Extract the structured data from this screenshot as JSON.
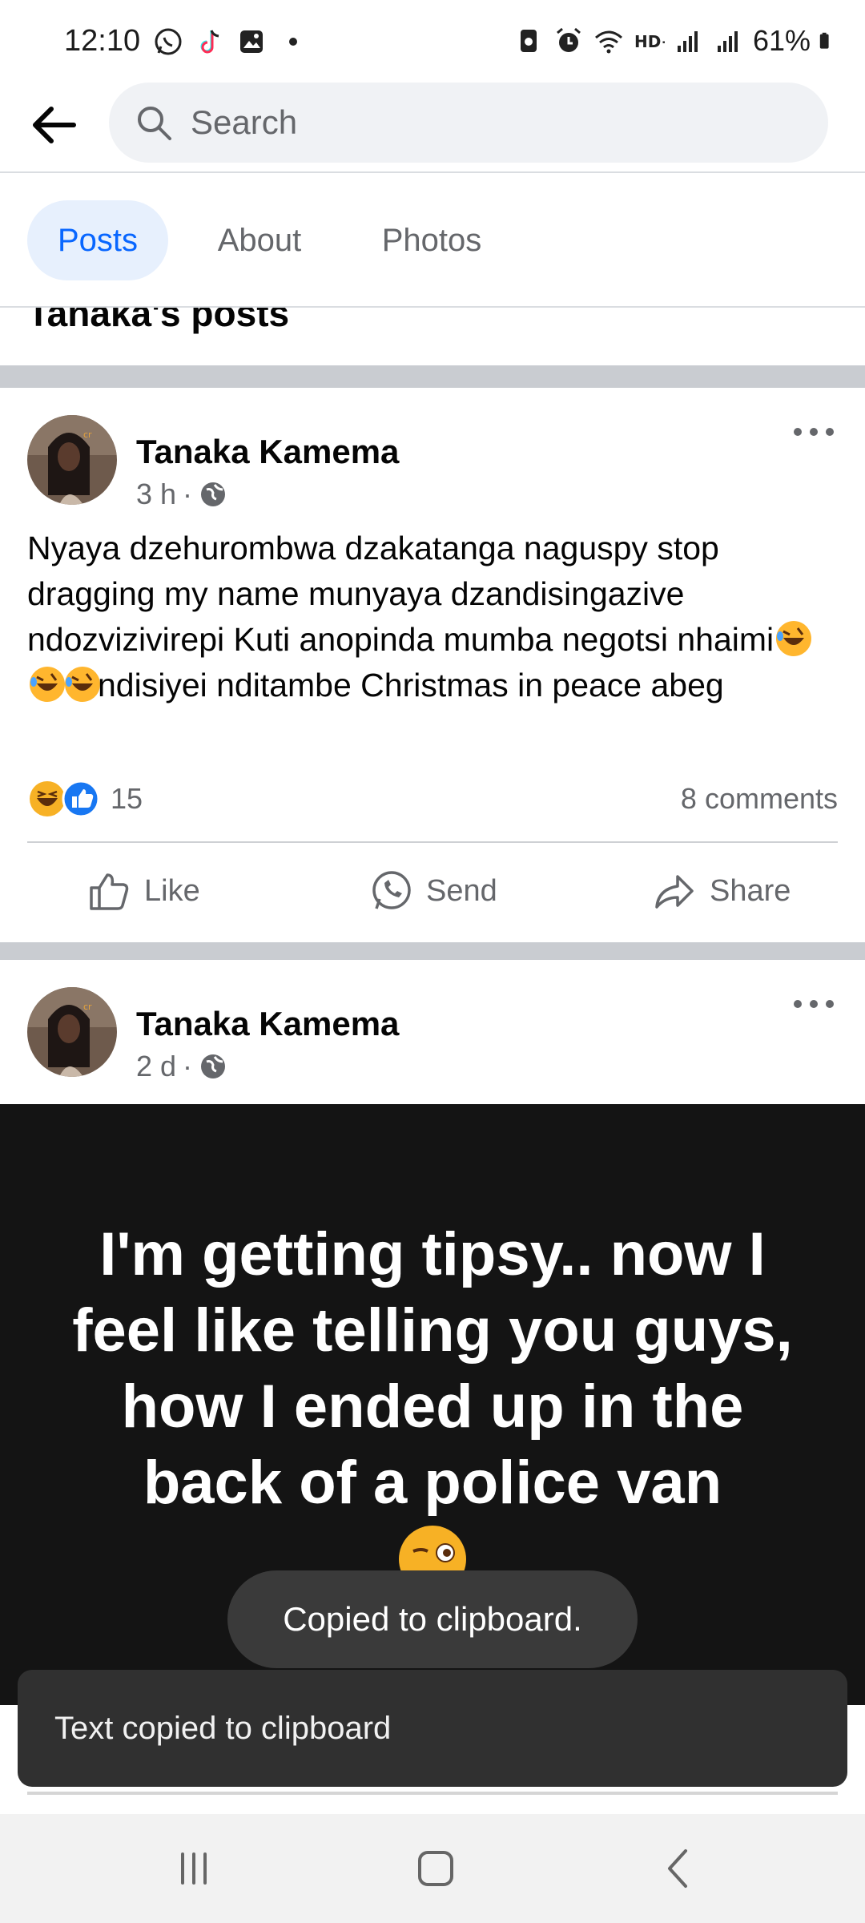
{
  "status_bar": {
    "time": "12:10",
    "battery": "61%"
  },
  "search": {
    "placeholder": "Search"
  },
  "tabs": [
    {
      "label": "Posts",
      "active": true
    },
    {
      "label": "About",
      "active": false
    },
    {
      "label": "Photos",
      "active": false
    }
  ],
  "section_title": "Tanaka's posts",
  "posts": [
    {
      "author": "Tanaka Kamema",
      "time": "3 h",
      "text_part1": "Nyaya dzehurombwa dzakatanga naguspy stop dragging my name munyaya dzandisingazive ndozvizivirepi Kuti anopinda mumba negotsi nhaimi",
      "text_part2": "ndisiyei nditambe Christmas in peace abeg",
      "reaction_count": "15",
      "comments": "8 comments",
      "actions": {
        "like": "Like",
        "send": "Send",
        "share": "Share"
      }
    },
    {
      "author": "Tanaka Kamema",
      "time": "2 d",
      "image_text": "I'm getting tipsy.. now I feel like telling you guys, how I ended up in the back of a police van"
    }
  ],
  "toasts": {
    "small": "Copied to clipboard.",
    "snackbar": "Text copied to clipboard"
  },
  "colors": {
    "accent": "#0866ff",
    "tab_active_bg": "#e7f0fd",
    "secondary_text": "#65676b"
  }
}
